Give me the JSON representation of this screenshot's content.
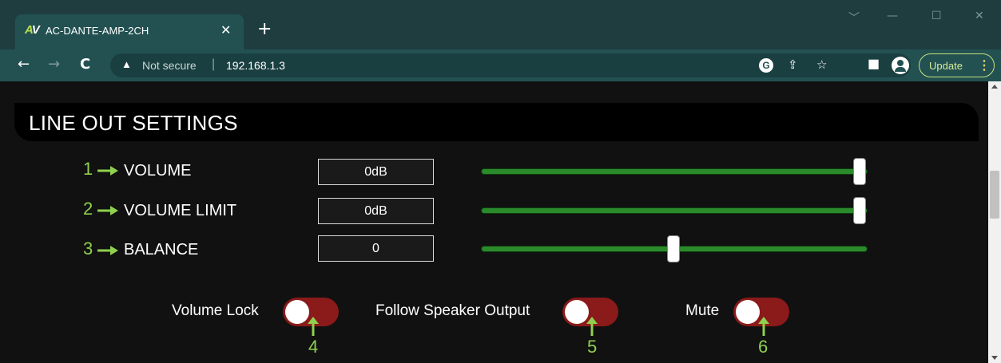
{
  "browser": {
    "tab_logo_a": "A",
    "tab_logo_v": "V",
    "tab_title": "AC-DANTE-AMP-2CH",
    "tab_close": "✕",
    "new_tab": "+",
    "win_dropdown": "﹀",
    "win_minimize": "—",
    "win_maximize": "☐",
    "win_close": "✕",
    "back": "←",
    "forward": "→",
    "reload": "C",
    "warning_icon": "▲",
    "not_secure": "Not secure",
    "separator": "|",
    "url": "192.168.1.3",
    "google_icon": "G",
    "share_icon": "⇪",
    "star_icon": "☆",
    "sidepanel_icon": "■",
    "update_label": "Update",
    "menu_dots": "⋮"
  },
  "section": {
    "title": "LINE OUT SETTINGS"
  },
  "rows": [
    {
      "num": "1",
      "label": "VOLUME",
      "value": "0dB",
      "slider_fraction": 1.0
    },
    {
      "num": "2",
      "label": "VOLUME LIMIT",
      "value": "0dB",
      "slider_fraction": 1.0
    },
    {
      "num": "3",
      "label": "BALANCE",
      "value": "0",
      "slider_fraction": 0.5
    }
  ],
  "toggles": [
    {
      "label": "Volume Lock",
      "num": "4",
      "state": "off"
    },
    {
      "label": "Follow Speaker Output",
      "num": "5",
      "state": "off"
    },
    {
      "label": "Mute",
      "num": "6",
      "state": "off"
    }
  ],
  "colors": {
    "chrome_titlebar": "#1f3d3f",
    "chrome_toolbar": "#235152",
    "slider_track": "#2b8a2b",
    "toggle_off": "#8b1a1a",
    "callout": "#8fd14f"
  }
}
